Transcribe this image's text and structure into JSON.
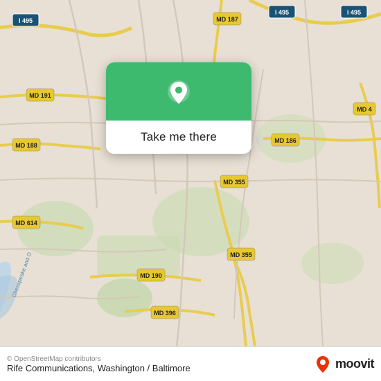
{
  "map": {
    "copyright": "© OpenStreetMap contributors",
    "title": "Rife Communications, Washington / Baltimore"
  },
  "popup": {
    "button_label": "Take me there",
    "pin_icon": "location-pin"
  },
  "footer": {
    "moovit_label": "moovit",
    "road_labels": [
      "I 495",
      "I 495",
      "MD 187",
      "MD 191",
      "MD 188",
      "MD 614",
      "MD 190",
      "MD 396",
      "MD 355",
      "MD 355",
      "MD 186",
      "MD 4"
    ]
  }
}
